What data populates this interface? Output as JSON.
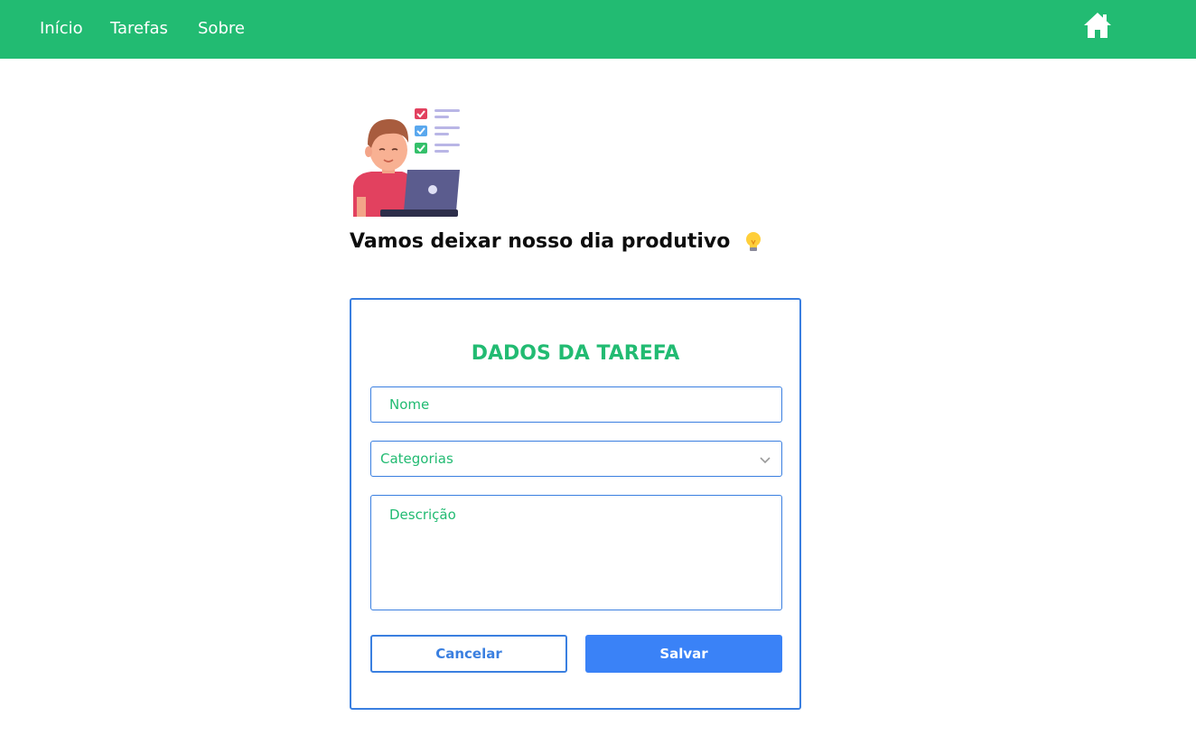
{
  "nav": {
    "links": [
      "Início",
      "Tarefas",
      "Sobre"
    ],
    "home_icon": "home-icon"
  },
  "hero": {
    "illustration": "person-with-laptop-checklist-illustration",
    "headline": "Vamos deixar nosso dia produtivo",
    "headline_icon": "lightbulb-icon"
  },
  "form": {
    "title": "DADOS DA TAREFA",
    "name_placeholder": "Nome",
    "category_placeholder": "Categorias",
    "description_placeholder": "Descrição",
    "cancel_label": "Cancelar",
    "save_label": "Salvar"
  },
  "colors": {
    "brand_green": "#22bb72",
    "accent_blue": "#3a82f7",
    "border_blue": "#3a7fe0"
  }
}
